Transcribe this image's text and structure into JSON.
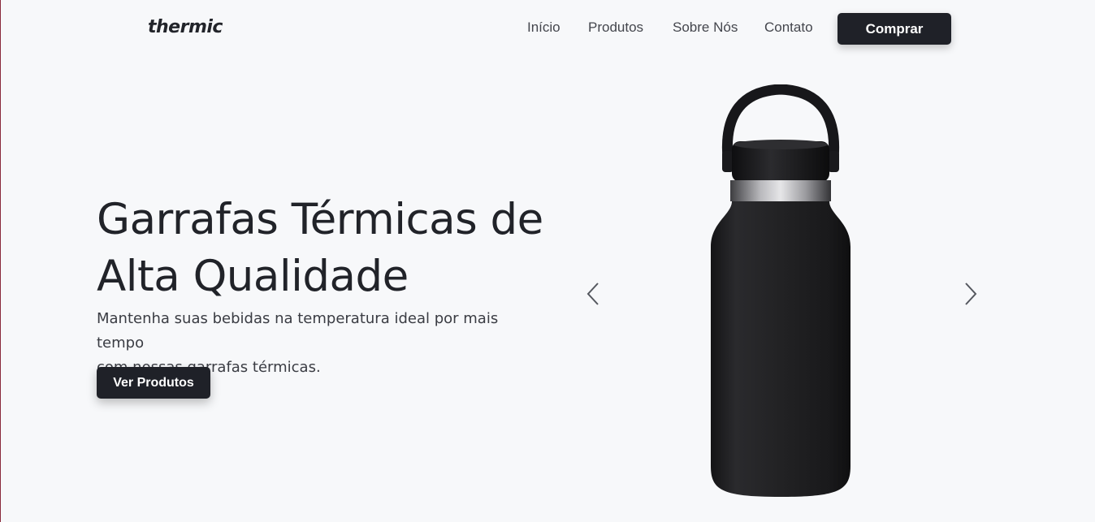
{
  "header": {
    "logo": "thermic",
    "nav": [
      "Início",
      "Produtos",
      "Sobre Nós",
      "Contato"
    ],
    "buy_label": "Comprar"
  },
  "hero": {
    "title_line1": "Garrafas Térmicas de",
    "title_line2": "Alta Qualidade",
    "subtitle_line1": "Mantenha suas bebidas na temperatura ideal por mais tempo",
    "subtitle_line2": "com nossas garrafas térmicas.",
    "cta_label": "Ver Produtos"
  },
  "carousel": {
    "prev_icon": "chevron-left-icon",
    "next_icon": "chevron-right-icon",
    "image": "black-thermal-bottle"
  },
  "colors": {
    "background": "#f7f8fa",
    "primary": "#1f2128",
    "text": "#212329"
  }
}
